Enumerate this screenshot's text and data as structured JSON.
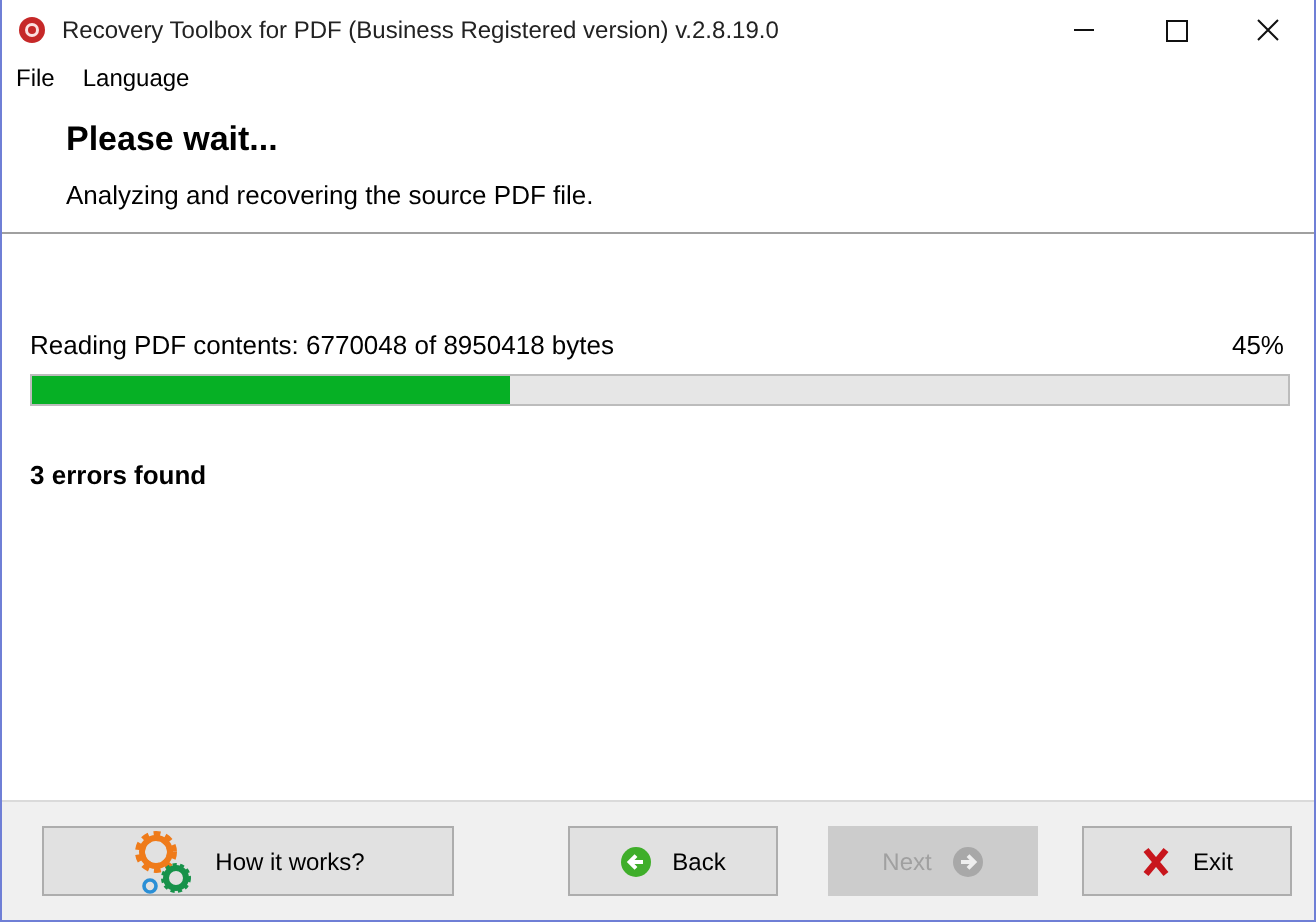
{
  "window": {
    "title": "Recovery Toolbox for PDF (Business Registered version) v.2.8.19.0"
  },
  "menu": [
    "File",
    "Language"
  ],
  "header": {
    "title": "Please wait...",
    "subtitle": "Analyzing and recovering the source PDF file."
  },
  "progress": {
    "label": "Reading PDF contents: 6770048 of 8950418 bytes",
    "percent": "45%",
    "level": 0.38
  },
  "errors": "3 errors found",
  "buttons": [
    {
      "label": "How it works?",
      "kind": "gears",
      "disabled": false
    },
    {
      "label": "Back",
      "kind": "back",
      "disabled": false
    },
    {
      "label": "Next",
      "kind": "next",
      "disabled": true
    },
    {
      "label": "Exit",
      "kind": "exit",
      "disabled": false
    }
  ]
}
